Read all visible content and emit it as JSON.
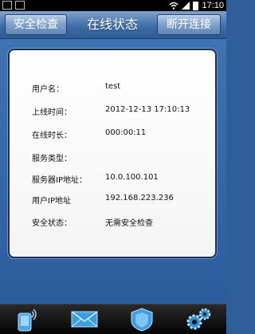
{
  "statusbar": {
    "time": "17:10"
  },
  "header": {
    "left_button": "安全检查",
    "title": "在线状态",
    "right_button": "断开连接"
  },
  "info": {
    "rows": [
      {
        "label": "用户名：",
        "value": "test"
      },
      {
        "label": "上线时间：",
        "value": "2012-12-13 17:10:13"
      },
      {
        "label": "在线时长：",
        "value": "000:00:11"
      },
      {
        "label": "服务类型：",
        "value": ""
      },
      {
        "label": "服务器IP地址：",
        "value": "10.0.100.101"
      },
      {
        "label": "用户IP地址",
        "value": "192.168.223.236"
      },
      {
        "label": "安全状态：",
        "value": "无需安全检查"
      }
    ]
  },
  "tabs": [
    {
      "icon": "phone-signal-icon"
    },
    {
      "icon": "mail-icon"
    },
    {
      "icon": "shield-icon"
    },
    {
      "icon": "gears-icon"
    }
  ],
  "colors": {
    "header": "#3c6aa4",
    "content": "#2f5f9a",
    "card": "#ffffff"
  }
}
